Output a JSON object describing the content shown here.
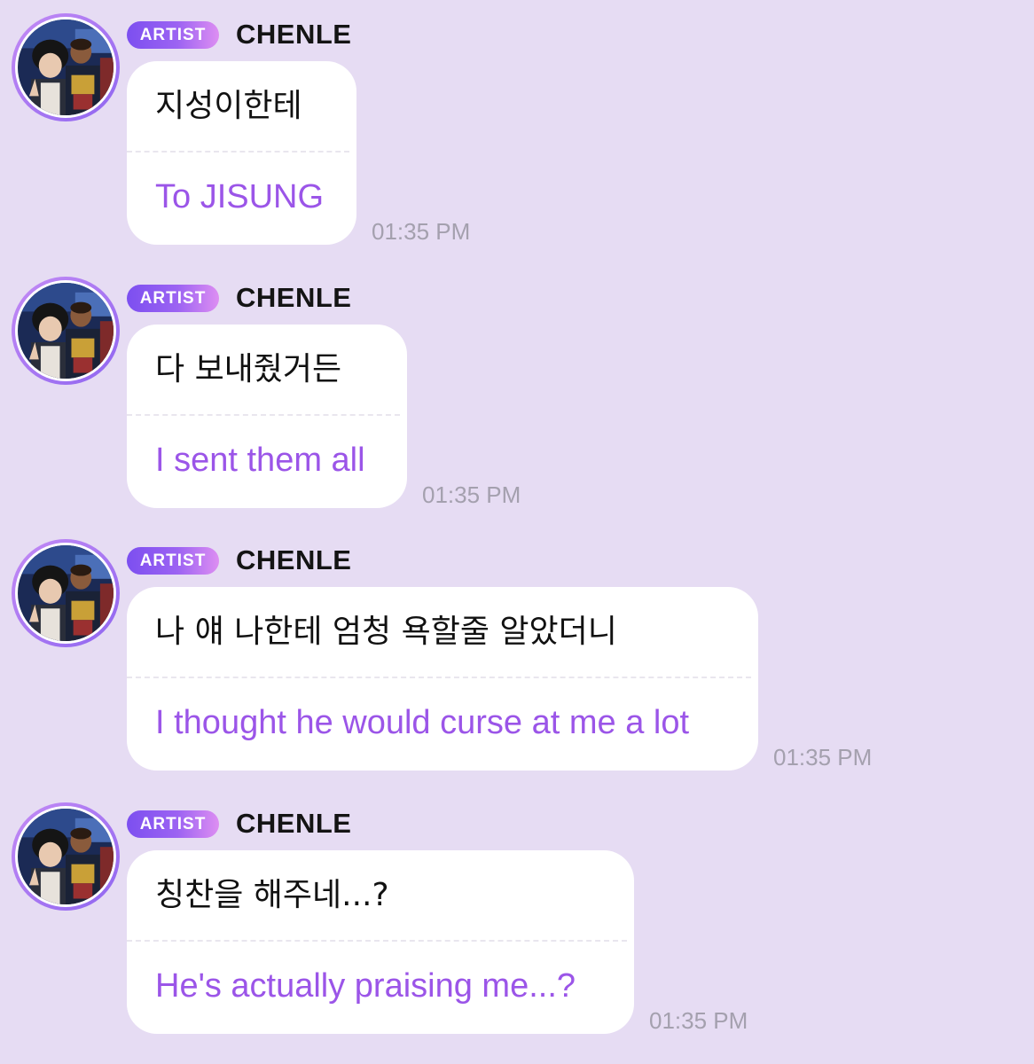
{
  "colors": {
    "background": "#e6dcf3",
    "bubble": "#ffffff",
    "translation_text": "#9b55e8",
    "badge_gradient_start": "#7c4ff0",
    "badge_gradient_end": "#dd8ef2",
    "timestamp": "#a4a0ae"
  },
  "messages": [
    {
      "avatar_icon": "avatar-photo",
      "badge": "ARTIST",
      "sender": "CHENLE",
      "original": "지성이한테",
      "translation": "To JISUNG",
      "time": "01:35 PM"
    },
    {
      "avatar_icon": "avatar-photo",
      "badge": "ARTIST",
      "sender": "CHENLE",
      "original": "다 보내줬거든",
      "translation": "I sent them all",
      "time": "01:35 PM"
    },
    {
      "avatar_icon": "avatar-photo",
      "badge": "ARTIST",
      "sender": "CHENLE",
      "original": "나 얘 나한테 엄청 욕할줄 알았더니",
      "translation": "I thought he would curse at me a lot",
      "time": "01:35 PM"
    },
    {
      "avatar_icon": "avatar-photo",
      "badge": "ARTIST",
      "sender": "CHENLE",
      "original": "칭찬을 해주네...?",
      "translation": "He's actually praising me...?",
      "time": "01:35 PM"
    }
  ]
}
